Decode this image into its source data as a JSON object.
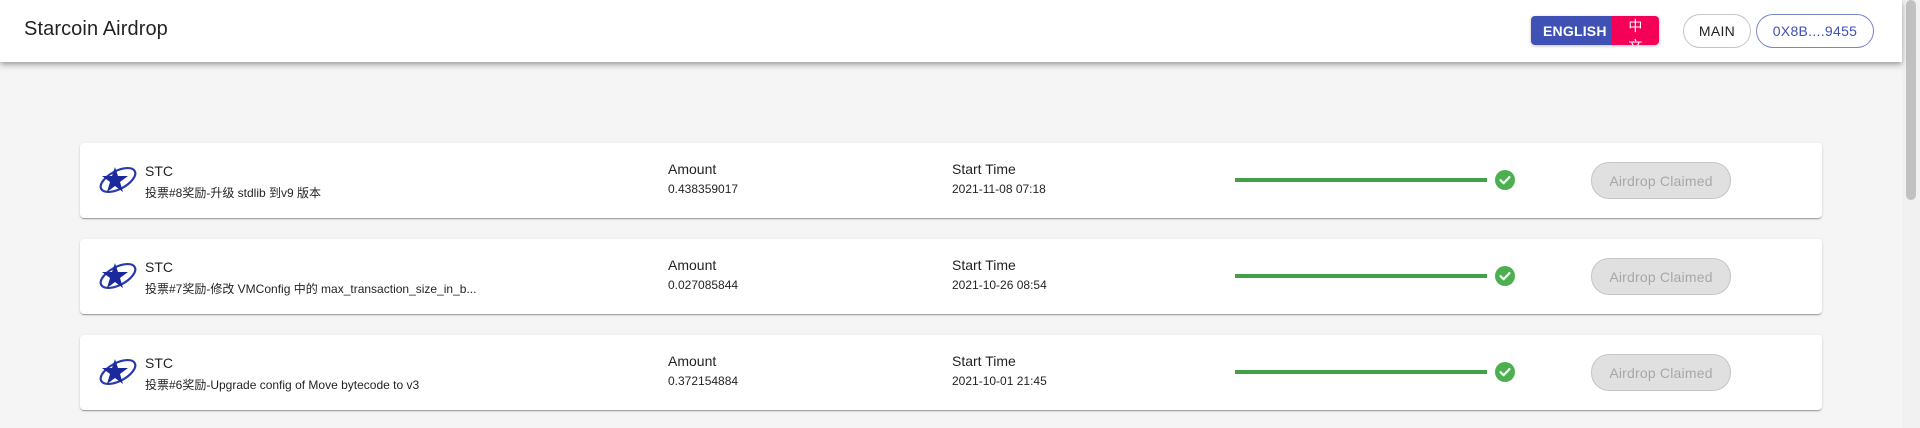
{
  "header": {
    "title": "Starcoin Airdrop",
    "lang_en": "ENGLISH",
    "lang_zh": "中文",
    "network": "MAIN",
    "account": "0X8B....9455"
  },
  "colors": {
    "primary": "#3f51b5",
    "secondary": "#f50057",
    "success": "#43a047"
  },
  "airdrops": [
    {
      "token": "STC",
      "description": "投票#8奖励-升级 stdlib 到v9 版本",
      "amount_label": "Amount",
      "amount": "0.438359017",
      "time_label": "Start Time",
      "start_time": "2021-11-08 07:18",
      "progress": 1.0,
      "status_icon": "check-circle-icon",
      "action": "Airdrop Claimed"
    },
    {
      "token": "STC",
      "description": "投票#7奖励-修改 VMConfig 中的 max_transaction_size_in_b...",
      "amount_label": "Amount",
      "amount": "0.027085844",
      "time_label": "Start Time",
      "start_time": "2021-10-26 08:54",
      "progress": 1.0,
      "status_icon": "check-circle-icon",
      "action": "Airdrop Claimed"
    },
    {
      "token": "STC",
      "description": "投票#6奖励-Upgrade config of Move bytecode to v3",
      "amount_label": "Amount",
      "amount": "0.372154884",
      "time_label": "Start Time",
      "start_time": "2021-10-01 21:45",
      "progress": 1.0,
      "status_icon": "check-circle-icon",
      "action": "Airdrop Claimed"
    }
  ]
}
